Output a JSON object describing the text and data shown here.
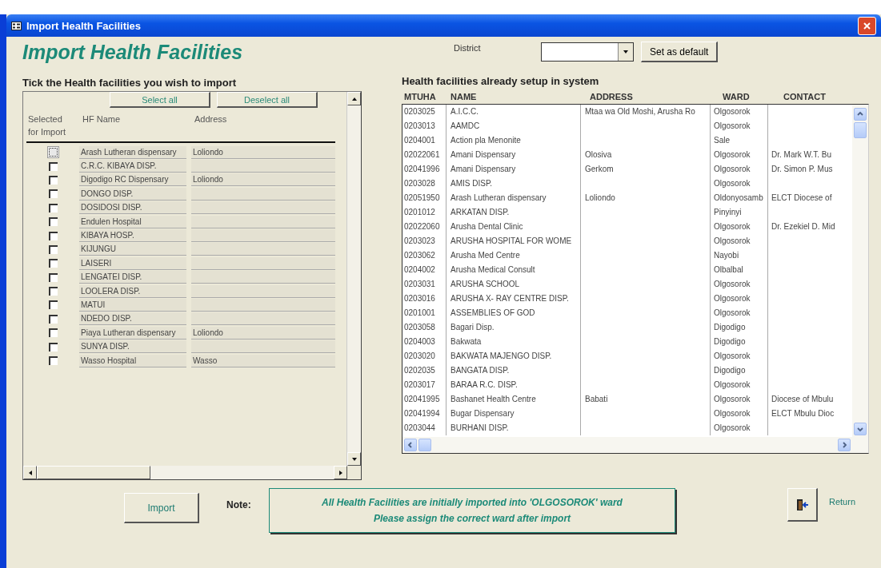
{
  "window": {
    "title": "Import Health Facilities"
  },
  "heading": "Import Health Facilities",
  "left_panel": {
    "title": "Tick the Health facilities you wish to import",
    "buttons": [
      "Select all",
      "Deselect all"
    ],
    "columns": [
      "Selected for Import",
      "HF Name",
      "Address"
    ],
    "facilities": [
      {
        "name": "Arash Lutheran dispensary",
        "address": "Loliondo",
        "checked": false,
        "focused": true
      },
      {
        "name": "C.R.C. KIBAYA DISP.",
        "checked": false,
        "focused": false
      },
      {
        "name": "Digodigo RC Dispensary",
        "address": "Loliondo",
        "checked": false,
        "focused": false
      },
      {
        "name": "DONGO DISP.",
        "checked": false,
        "focused": false
      },
      {
        "name": "DOSIDOSI DISP.",
        "checked": false,
        "focused": false
      },
      {
        "name": "Endulen Hospital",
        "checked": false,
        "focused": false
      },
      {
        "name": "KIBAYA HOSP.",
        "checked": false,
        "focused": false
      },
      {
        "name": "KIJUNGU",
        "checked": false,
        "focused": false
      },
      {
        "name": "LAISERI",
        "checked": false,
        "focused": false
      },
      {
        "name": "LENGATEI DISP.",
        "checked": false,
        "focused": false
      },
      {
        "name": "LOOLERA DISP.",
        "checked": false,
        "focused": false
      },
      {
        "name": "MATUI",
        "checked": false,
        "focused": false
      },
      {
        "name": "NDEDO DISP.",
        "checked": false,
        "focused": false
      },
      {
        "name": "Piaya Lutheran dispensary",
        "address": "Loliondo",
        "checked": false,
        "focused": false
      },
      {
        "name": "SUNYA DISP.",
        "checked": false,
        "focused": false
      },
      {
        "name": "Wasso Hospital",
        "address": "Wasso",
        "checked": false,
        "focused": false
      }
    ]
  },
  "district": {
    "label": "District",
    "button": "Set as default"
  },
  "right_panel": {
    "title": "Health facilities already setup in system",
    "columns": [
      "MTUHA",
      "NAME",
      "ADDRESS",
      "WARD",
      "CONTACT"
    ],
    "rows": [
      {
        "mtuha": "0203025",
        "name": "A.I.C.C.",
        "address": "Mtaa wa Old Moshi, Arusha Ro",
        "ward": "Olgosorok"
      },
      {
        "mtuha": "0203013",
        "name": "AAMDC",
        "ward": "Olgosorok"
      },
      {
        "mtuha": "0204001",
        "name": "Action pla Menonite",
        "ward": "Sale"
      },
      {
        "mtuha": "02022061",
        "name": "Amani Dispensary",
        "address": "Olosiva",
        "ward": "Olgosorok",
        "contact": "Dr. Mark W.T. Bu"
      },
      {
        "mtuha": "02041996",
        "name": "Amani Dispensary",
        "address": "Gerkom",
        "ward": "Olgosorok",
        "contact": "Dr. Simon P. Mus"
      },
      {
        "mtuha": "0203028",
        "name": "AMIS DISP.",
        "ward": "Olgosorok"
      },
      {
        "mtuha": "02051950",
        "name": "Arash Lutheran dispensary",
        "address": "Loliondo",
        "ward": "Oldonyosamb",
        "contact": "ELCT Diocese of"
      },
      {
        "mtuha": "0201012",
        "name": "ARKATAN DISP.",
        "ward": "Pinyinyi"
      },
      {
        "mtuha": "02022060",
        "name": "Arusha Dental Clinic",
        "ward": "Olgosorok",
        "contact": "Dr. Ezekiel D. Mid"
      },
      {
        "mtuha": "0203023",
        "name": "ARUSHA HOSPITAL FOR WOME",
        "ward": "Olgosorok"
      },
      {
        "mtuha": "0203062",
        "name": "Arusha Med Centre",
        "ward": "Nayobi"
      },
      {
        "mtuha": "0204002",
        "name": "Arusha Medical Consult",
        "ward": "Olbalbal"
      },
      {
        "mtuha": "0203031",
        "name": "ARUSHA SCHOOL",
        "ward": "Olgosorok"
      },
      {
        "mtuha": "0203016",
        "name": "ARUSHA X- RAY CENTRE DISP.",
        "ward": "Olgosorok"
      },
      {
        "mtuha": "0201001",
        "name": "ASSEMBLIES OF GOD",
        "ward": "Olgosorok"
      },
      {
        "mtuha": "0203058",
        "name": "Bagari Disp.",
        "ward": "Digodigo"
      },
      {
        "mtuha": "0204003",
        "name": "Bakwata",
        "ward": "Digodigo"
      },
      {
        "mtuha": "0203020",
        "name": "BAKWATA MAJENGO DISP.",
        "ward": "Olgosorok"
      },
      {
        "mtuha": "0202035",
        "name": "BANGATA DISP.",
        "ward": "Digodigo"
      },
      {
        "mtuha": "0203017",
        "name": "BARAA R.C. DISP.",
        "ward": "Olgosorok"
      },
      {
        "mtuha": "02041995",
        "name": "Bashanet Health Centre",
        "address": "Babati",
        "ward": "Olgosorok",
        "contact": "Diocese of Mbulu"
      },
      {
        "mtuha": "02041994",
        "name": "Bugar Dispensary",
        "ward": "Olgosorok",
        "contact": "ELCT Mbulu Dioc"
      },
      {
        "mtuha": "0203044",
        "name": "BURHANI DISP.",
        "ward": "Olgosorok"
      }
    ]
  },
  "footer": {
    "import_button": "Import",
    "note_label": "Note:",
    "note_lines": [
      "All Health Facilities are initially imported into 'OLGOSOROK' ward",
      "Please assign the correct ward after import"
    ],
    "return_label": "Return"
  }
}
